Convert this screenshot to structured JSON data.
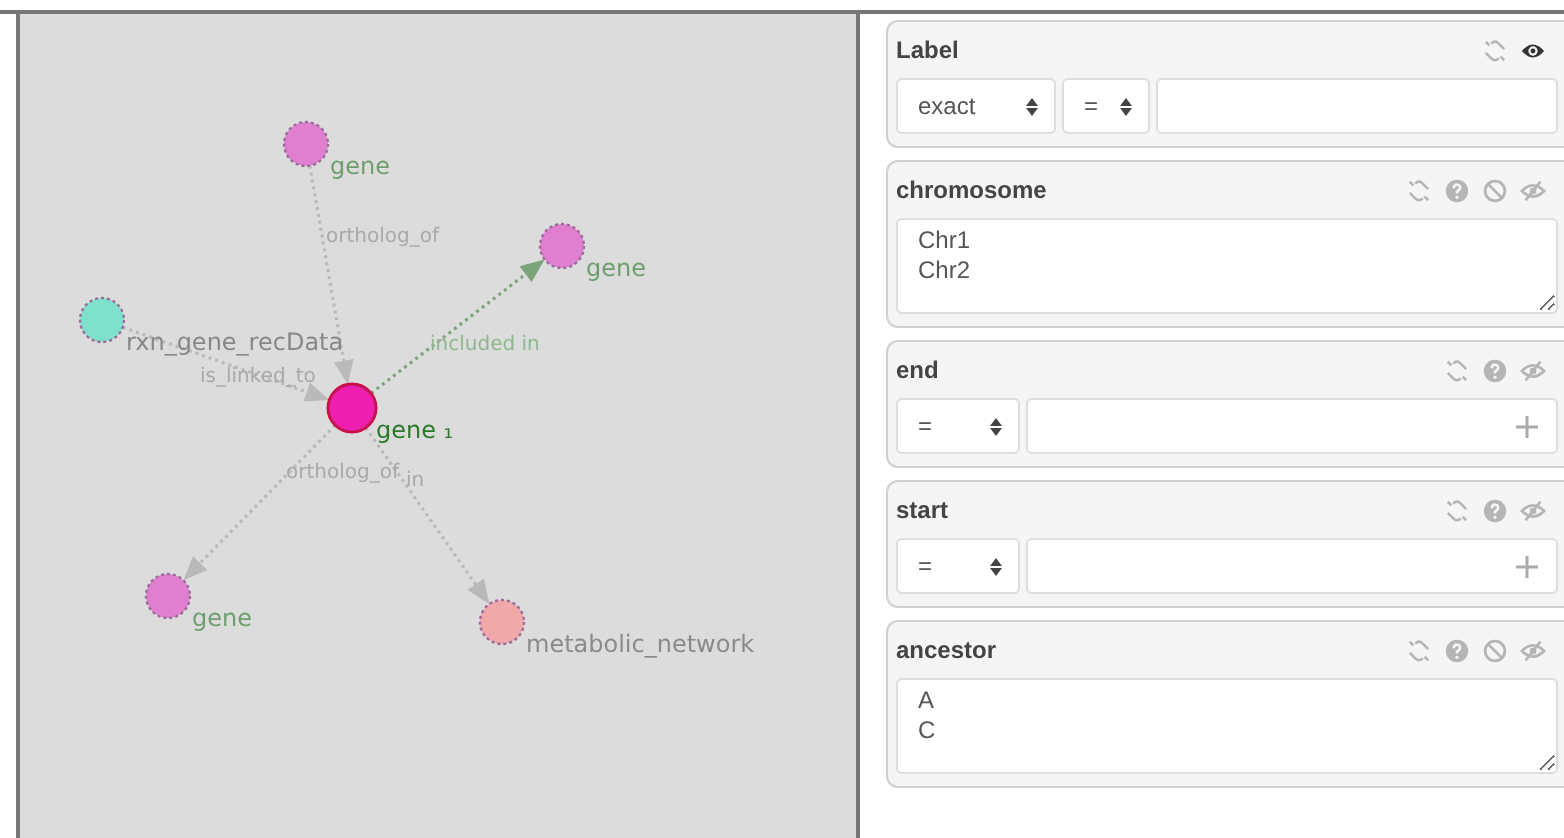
{
  "graph": {
    "nodes": [
      {
        "label": "gene",
        "kind": "gene",
        "color": "#e07fd0",
        "selected": false
      },
      {
        "label": "gene",
        "kind": "gene",
        "color": "#e07fd0",
        "selected": false
      },
      {
        "label": "rxn_gene_recData",
        "kind": "reaction",
        "color": "#7fe0cc",
        "selected": false
      },
      {
        "label": "gene ₁",
        "kind": "gene",
        "color": "#ec1fb0",
        "selected": true
      },
      {
        "label": "gene",
        "kind": "gene",
        "color": "#e07fd0",
        "selected": false
      },
      {
        "label": "metabolic_network",
        "kind": "network",
        "color": "#f0a8a8",
        "selected": false
      }
    ],
    "edges": [
      {
        "label": "ortholog_of",
        "highlighted": false
      },
      {
        "label": "included in",
        "highlighted": true
      },
      {
        "label": "is_linked_to",
        "highlighted": false
      },
      {
        "label": "ortholog_of",
        "highlighted": false
      },
      {
        "label": "in",
        "highlighted": false
      }
    ]
  },
  "filters": [
    {
      "title": "Label",
      "kind": "text",
      "icons": [
        {
          "kind": "unlink",
          "active": false
        },
        {
          "kind": "eye",
          "active": true
        }
      ],
      "selects": [
        "exact",
        "="
      ]
    },
    {
      "title": "chromosome",
      "kind": "list",
      "icons": [
        {
          "kind": "unlink",
          "active": false
        },
        {
          "kind": "help",
          "active": false
        },
        {
          "kind": "block",
          "active": false
        },
        {
          "kind": "eye-slash",
          "active": false
        }
      ],
      "lines": [
        "Chr1",
        "Chr2"
      ]
    },
    {
      "title": "end",
      "kind": "range",
      "icons": [
        {
          "kind": "unlink",
          "active": false
        },
        {
          "kind": "help",
          "active": false
        },
        {
          "kind": "eye-slash",
          "active": false
        }
      ],
      "selects": [
        "="
      ]
    },
    {
      "title": "start",
      "kind": "range",
      "icons": [
        {
          "kind": "unlink",
          "active": false
        },
        {
          "kind": "help",
          "active": false
        },
        {
          "kind": "eye-slash",
          "active": false
        }
      ],
      "selects": [
        "="
      ]
    },
    {
      "title": "ancestor",
      "kind": "list",
      "icons": [
        {
          "kind": "unlink",
          "active": false
        },
        {
          "kind": "help",
          "active": false
        },
        {
          "kind": "block",
          "active": false
        },
        {
          "kind": "eye-slash",
          "active": false
        }
      ],
      "lines": [
        "A",
        "C"
      ]
    }
  ]
}
